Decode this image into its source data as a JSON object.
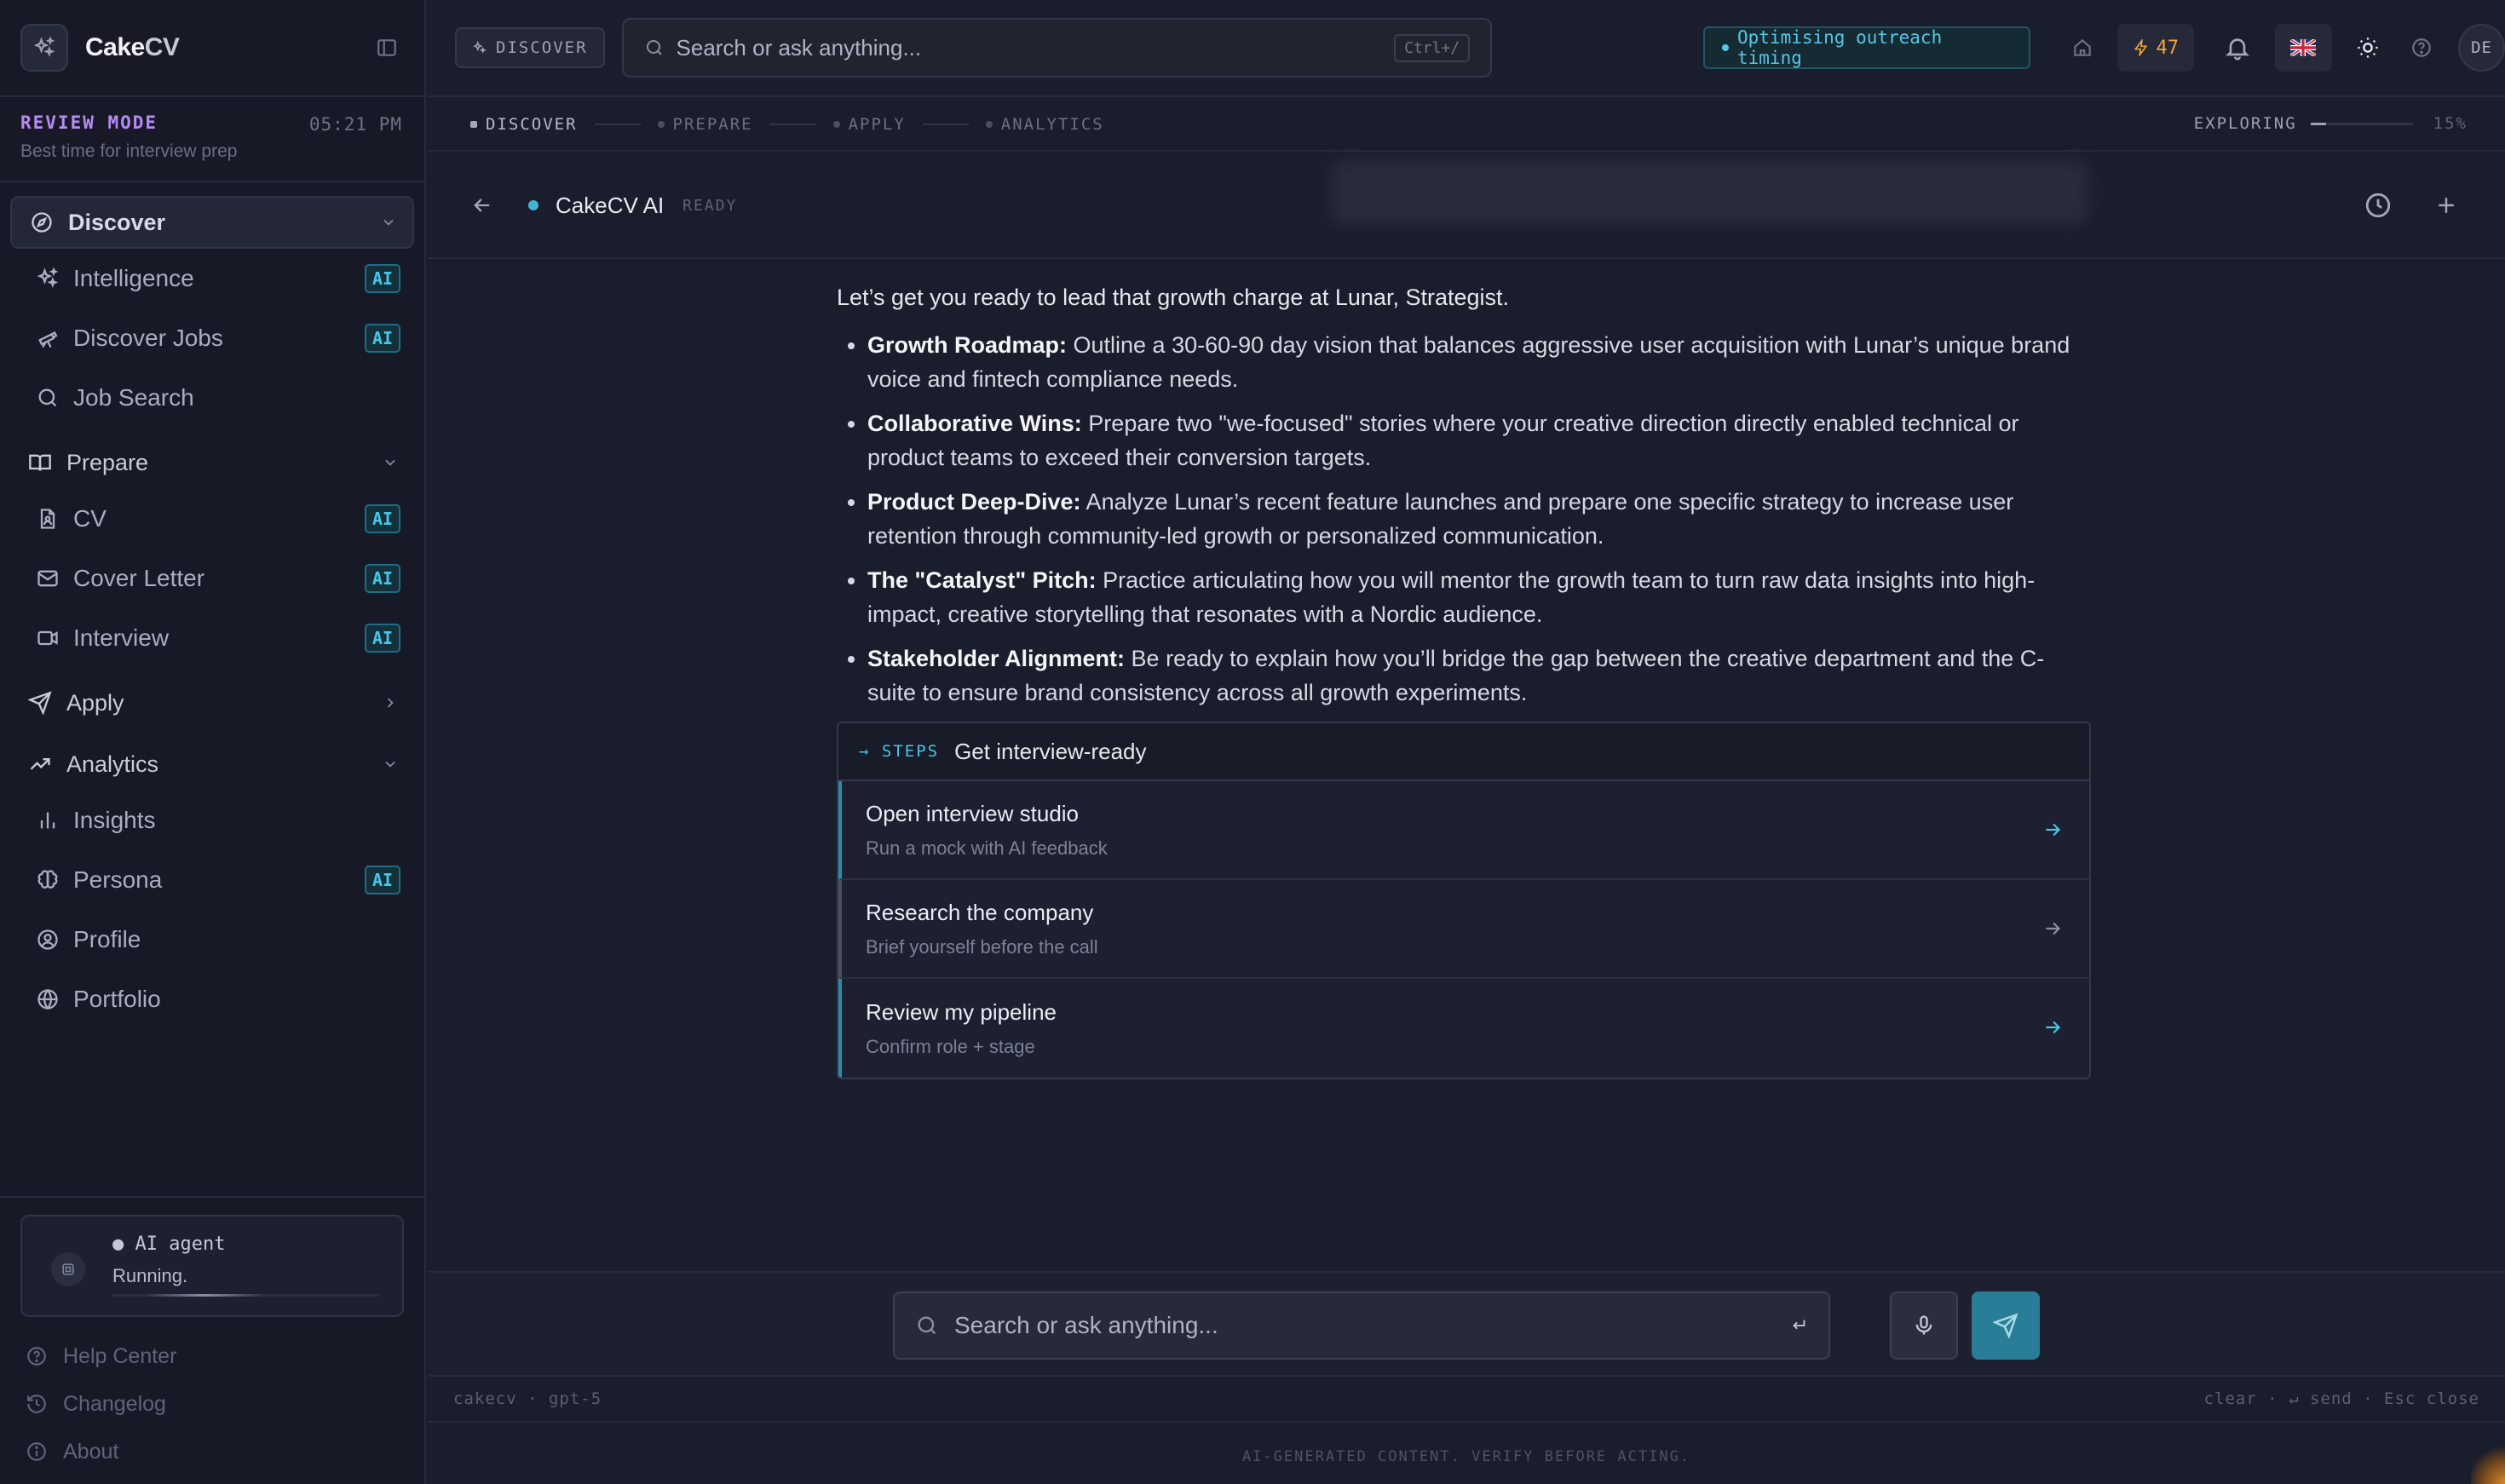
{
  "app": {
    "name_main": "Cake",
    "name_accent": "CV"
  },
  "mode": {
    "title": "REVIEW MODE",
    "time": "05:21 PM",
    "subtitle": "Best time for interview prep"
  },
  "sidebar": {
    "groups": {
      "discover": "Discover",
      "prepare": "Prepare",
      "apply": "Apply",
      "analytics": "Analytics"
    },
    "items": {
      "intelligence": "Intelligence",
      "discover_jobs": "Discover Jobs",
      "job_search": "Job Search",
      "cv": "CV",
      "cover_letter": "Cover Letter",
      "interview": "Interview",
      "insights": "Insights",
      "persona": "Persona",
      "profile": "Profile",
      "portfolio": "Portfolio"
    },
    "ai_badge": "AI",
    "agent": {
      "title": "AI agent",
      "status": "Running.",
      "progress": 0.45
    },
    "footer": {
      "help": "Help Center",
      "changelog": "Changelog",
      "about": "About"
    }
  },
  "topbar": {
    "chip": "DISCOVER",
    "search_placeholder": "Search or ask anything...",
    "shortcut": "Ctrl+/",
    "status": "Optimising outreach timing",
    "credits": "47",
    "avatar": "DE"
  },
  "stepper": {
    "steps": [
      "DISCOVER",
      "PREPARE",
      "APPLY",
      "ANALYTICS"
    ],
    "explore_label": "EXPLORING",
    "explore_pct": "15%",
    "explore_value": 0.15
  },
  "chat": {
    "title": "CakeCV AI",
    "state": "READY",
    "intro": "Let’s get you ready to lead that growth charge at Lunar, Strategist.",
    "bullets": [
      {
        "bold": "Growth Roadmap:",
        "text": " Outline a 30-60-90 day vision that balances aggressive user acquisition with Lunar’s unique brand voice and fintech compliance needs."
      },
      {
        "bold": "Collaborative Wins:",
        "text": " Prepare two \"we-focused\" stories where your creative direction directly enabled technical or product teams to exceed their conversion targets."
      },
      {
        "bold": "Product Deep-Dive:",
        "text": " Analyze Lunar’s recent feature launches and prepare one specific strategy to increase user retention through community-led growth or personalized communication."
      },
      {
        "bold": "The \"Catalyst\" Pitch:",
        "text": " Practice articulating how you will mentor the growth team to turn raw data insights into high-impact, creative storytelling that resonates with a Nordic audience."
      },
      {
        "bold": "Stakeholder Alignment:",
        "text": " Be ready to explain how you’ll bridge the gap between the creative department and the C-suite to ensure brand consistency across all growth experiments."
      }
    ],
    "steps_tag": "→ STEPS",
    "steps_title": "Get interview-ready",
    "steps": [
      {
        "title": "Open interview studio",
        "sub": "Run a mock with AI feedback"
      },
      {
        "title": "Research the company",
        "sub": "Brief yourself before the call"
      },
      {
        "title": "Review my pipeline",
        "sub": "Confirm role + stage"
      }
    ]
  },
  "composer": {
    "placeholder": "Search or ask anything...",
    "meta_left": "cakecv · gpt-5",
    "meta_right": "clear · ↵ send · Esc close",
    "disclaimer": "AI-GENERATED CONTENT. VERIFY BEFORE ACTING."
  },
  "colors": {
    "accent": "#46c7e6",
    "purple": "#b78bf5",
    "credits": "#f0a43a",
    "send": "#2a7d96"
  }
}
